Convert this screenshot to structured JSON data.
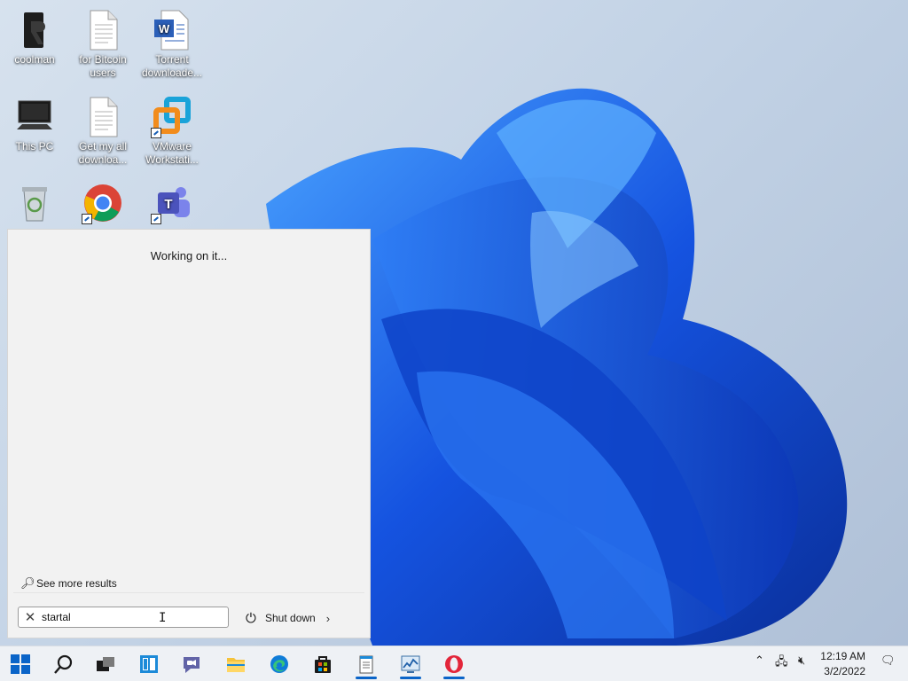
{
  "desktop": {
    "icons": [
      {
        "label": "coolman",
        "icon": "dark-app-icon"
      },
      {
        "label": "for Bitcoin users",
        "icon": "text-document-icon"
      },
      {
        "label": "Torrent downloade...",
        "icon": "word-document-icon"
      },
      {
        "label": "This PC",
        "icon": "computer-icon"
      },
      {
        "label": "Get my all downloa...",
        "icon": "text-document-icon"
      },
      {
        "label": "VMware Workstati...",
        "icon": "vmware-icon"
      },
      {
        "label": "",
        "icon": "recycle-bin-icon"
      },
      {
        "label": "",
        "icon": "chrome-icon"
      },
      {
        "label": "",
        "icon": "teams-icon"
      }
    ]
  },
  "search_panel": {
    "status_text": "Working on it...",
    "see_more_label": "See more results",
    "query_value": "startal",
    "shutdown_label": "Shut down"
  },
  "taskbar": {
    "items": [
      {
        "name": "start-button",
        "icon": "windows-logo-icon"
      },
      {
        "name": "search-button",
        "icon": "search-icon"
      },
      {
        "name": "task-view-button",
        "icon": "task-view-icon"
      },
      {
        "name": "widgets-button",
        "icon": "widgets-icon"
      },
      {
        "name": "chat-button",
        "icon": "chat-icon"
      },
      {
        "name": "file-explorer-button",
        "icon": "folder-icon"
      },
      {
        "name": "edge-button",
        "icon": "edge-icon"
      },
      {
        "name": "store-button",
        "icon": "store-icon"
      },
      {
        "name": "notepad-button",
        "icon": "notepad-icon"
      },
      {
        "name": "resource-monitor-button",
        "icon": "monitor-chart-icon"
      },
      {
        "name": "opera-button",
        "icon": "opera-icon"
      }
    ],
    "time": "12:19 AM",
    "date": "3/2/2022"
  },
  "colors": {
    "accent": "#0a64c8",
    "wallpaper_bloom": "#1f5fe0",
    "panel_bg": "#f2f2f2"
  }
}
